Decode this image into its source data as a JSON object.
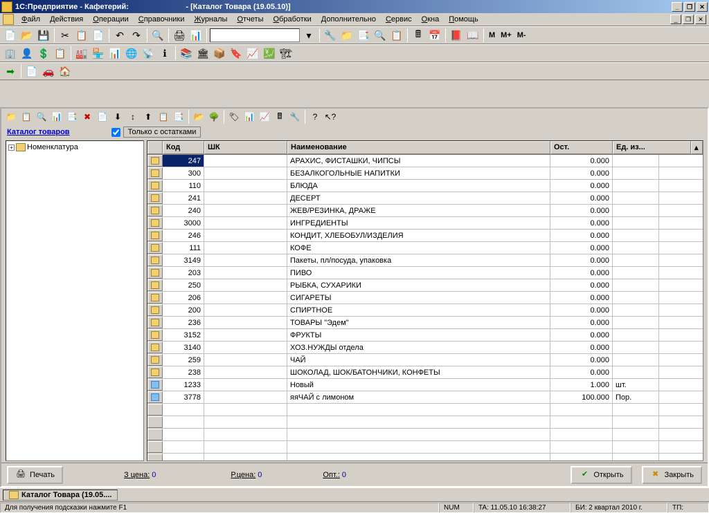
{
  "title": "1С:Предприятие - Кафетерий:",
  "subtitle": "- [Каталог Товара (19.05.10)]",
  "menu": [
    "Файл",
    "Действия",
    "Операции",
    "Справочники",
    "Журналы",
    "Отчеты",
    "Обработки",
    "Дополнительно",
    "Сервис",
    "Окна",
    "Помощь"
  ],
  "toolbar3_text": [
    "M",
    "M+",
    "M-"
  ],
  "catalog_link": "Каталог товаров",
  "checkbox_label": "Только с остатками",
  "tree_root": "Номенклатура",
  "columns": [
    "",
    "Код",
    "ШК",
    "Наименование",
    "Ост.",
    "Ед. из..."
  ],
  "rows": [
    {
      "icon": "y",
      "code": "247",
      "sk": "",
      "name": "АРАХИС, ФИСТАШКИ, ЧИПСЫ",
      "ost": "0.000",
      "ed": "",
      "sel": true
    },
    {
      "icon": "y",
      "code": "300",
      "sk": "",
      "name": "БЕЗАЛКОГОЛЬНЫЕ НАПИТКИ",
      "ost": "0.000",
      "ed": ""
    },
    {
      "icon": "y",
      "code": "110",
      "sk": "",
      "name": "БЛЮДА",
      "ost": "0.000",
      "ed": ""
    },
    {
      "icon": "y",
      "code": "241",
      "sk": "",
      "name": "ДЕСЕРТ",
      "ost": "0.000",
      "ed": ""
    },
    {
      "icon": "y",
      "code": "240",
      "sk": "",
      "name": "ЖЕВ/РЕЗИНКА, ДРАЖЕ",
      "ost": "0.000",
      "ed": ""
    },
    {
      "icon": "y",
      "code": "3000",
      "sk": "",
      "name": "ИНГРЕДИЕНТЫ",
      "ost": "0.000",
      "ed": ""
    },
    {
      "icon": "y",
      "code": "246",
      "sk": "",
      "name": "КОНДИТ, ХЛЕБОБУЛ/ИЗДЕЛИЯ",
      "ost": "0.000",
      "ed": ""
    },
    {
      "icon": "y",
      "code": "111",
      "sk": "",
      "name": "КОФЕ",
      "ost": "0.000",
      "ed": ""
    },
    {
      "icon": "y",
      "code": "3149",
      "sk": "",
      "name": "Пакеты, пл/посуда, упаковка",
      "ost": "0.000",
      "ed": ""
    },
    {
      "icon": "y",
      "code": "203",
      "sk": "",
      "name": "ПИВО",
      "ost": "0.000",
      "ed": ""
    },
    {
      "icon": "y",
      "code": "250",
      "sk": "",
      "name": "РЫБКА, СУХАРИКИ",
      "ost": "0.000",
      "ed": ""
    },
    {
      "icon": "y",
      "code": "206",
      "sk": "",
      "name": "СИГАРЕТЫ",
      "ost": "0.000",
      "ed": ""
    },
    {
      "icon": "y",
      "code": "200",
      "sk": "",
      "name": "СПИРТНОЕ",
      "ost": "0.000",
      "ed": ""
    },
    {
      "icon": "y",
      "code": "236",
      "sk": "",
      "name": "ТОВАРЫ \"Эдем\"",
      "ost": "0.000",
      "ed": ""
    },
    {
      "icon": "y",
      "code": "3152",
      "sk": "",
      "name": "ФРУКТЫ",
      "ost": "0.000",
      "ed": ""
    },
    {
      "icon": "y",
      "code": "3140",
      "sk": "",
      "name": "ХОЗ.НУЖДЫ отдела",
      "ost": "0.000",
      "ed": ""
    },
    {
      "icon": "y",
      "code": "259",
      "sk": "",
      "name": "ЧАЙ",
      "ost": "0.000",
      "ed": ""
    },
    {
      "icon": "y",
      "code": "238",
      "sk": "",
      "name": "ШОКОЛАД, ШОК/БАТОНЧИКИ, КОНФЕТЫ",
      "ost": "0.000",
      "ed": ""
    },
    {
      "icon": "b",
      "code": "1233",
      "sk": "",
      "name": "Новый",
      "ost": "1.000",
      "ed": "шт."
    },
    {
      "icon": "b",
      "code": "3778",
      "sk": "",
      "name": "яяЧАЙ с лимоном",
      "ost": "100.000",
      "ed": "Пор."
    }
  ],
  "buttons": {
    "print": "Печать",
    "open": "Открыть",
    "close": "Закрыть"
  },
  "prices": {
    "z": "З цена:",
    "zval": "0",
    "r": "Р.цена:",
    "rval": "0",
    "o": "Опт.:",
    "oval": "0"
  },
  "taskbar": "Каталог Товара (19.05....",
  "status": {
    "hint": "Для получения подсказки нажмите F1",
    "num": "NUM",
    "ta": "TA: 11.05.10  16:38:27",
    "bi": "БИ: 2 квартал 2010 г.",
    "tp": "ТП:"
  }
}
